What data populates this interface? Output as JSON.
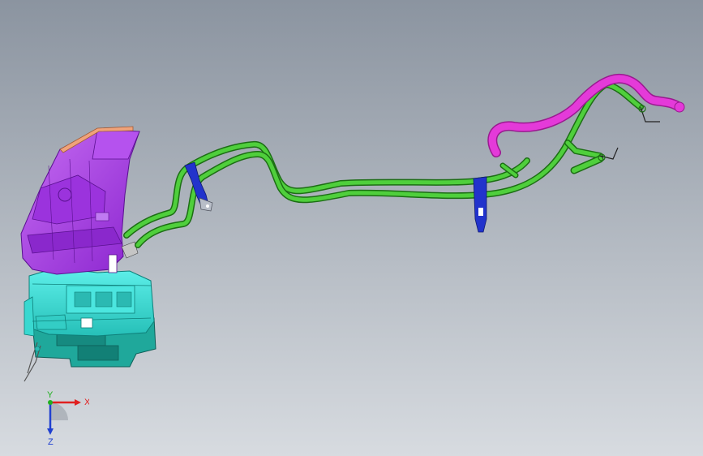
{
  "viewport": {
    "background_top": "#8b94a0",
    "background_bottom": "#d7dbe0"
  },
  "assembly": {
    "parts": [
      {
        "name": "hvac-housing",
        "color": "#3fe3dc"
      },
      {
        "name": "hvac-lower-case",
        "color": "#1fa89b"
      },
      {
        "name": "air-duct",
        "color": "#a23ce6"
      },
      {
        "name": "duct-top-trim",
        "color": "#f0a37a"
      },
      {
        "name": "coolant-pipes",
        "color": "#3db32d"
      },
      {
        "name": "pipe-brackets",
        "color": "#2233cc"
      },
      {
        "name": "hose-end",
        "color": "#e43ad9"
      }
    ]
  },
  "triad": {
    "x_label": "X",
    "y_label": "Y",
    "z_label": "Z",
    "x_color": "#e02020",
    "y_color": "#20b020",
    "z_color": "#2040d0"
  }
}
